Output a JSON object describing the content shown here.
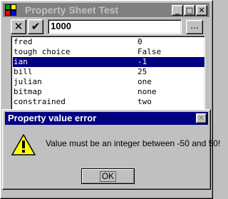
{
  "window": {
    "title": "Property Sheet Test",
    "minimize_glyph": "_",
    "maximize_glyph": "□",
    "close_glyph": "✕"
  },
  "toolbar": {
    "cancel_glyph": "✕",
    "accept_glyph": "✔",
    "value": "1000",
    "browse_label": "..."
  },
  "properties": [
    {
      "name": "fred",
      "value": "0"
    },
    {
      "name": "tough choice",
      "value": "False"
    },
    {
      "name": "ian",
      "value": "-1",
      "selected": true
    },
    {
      "name": "bill",
      "value": "25"
    },
    {
      "name": "julian",
      "value": "one"
    },
    {
      "name": "bitmap",
      "value": "none"
    },
    {
      "name": "constrained",
      "value": "two"
    }
  ],
  "dialog": {
    "title": "Property value error",
    "message": "Value must be an integer between -50 and 50!",
    "ok_label": "OK",
    "close_glyph": "✕"
  },
  "colors": {
    "face": "#c0c0c0",
    "selection": "#000080",
    "active_title": "#000080",
    "inactive_title": "#808080",
    "warning": "#ffff00"
  }
}
